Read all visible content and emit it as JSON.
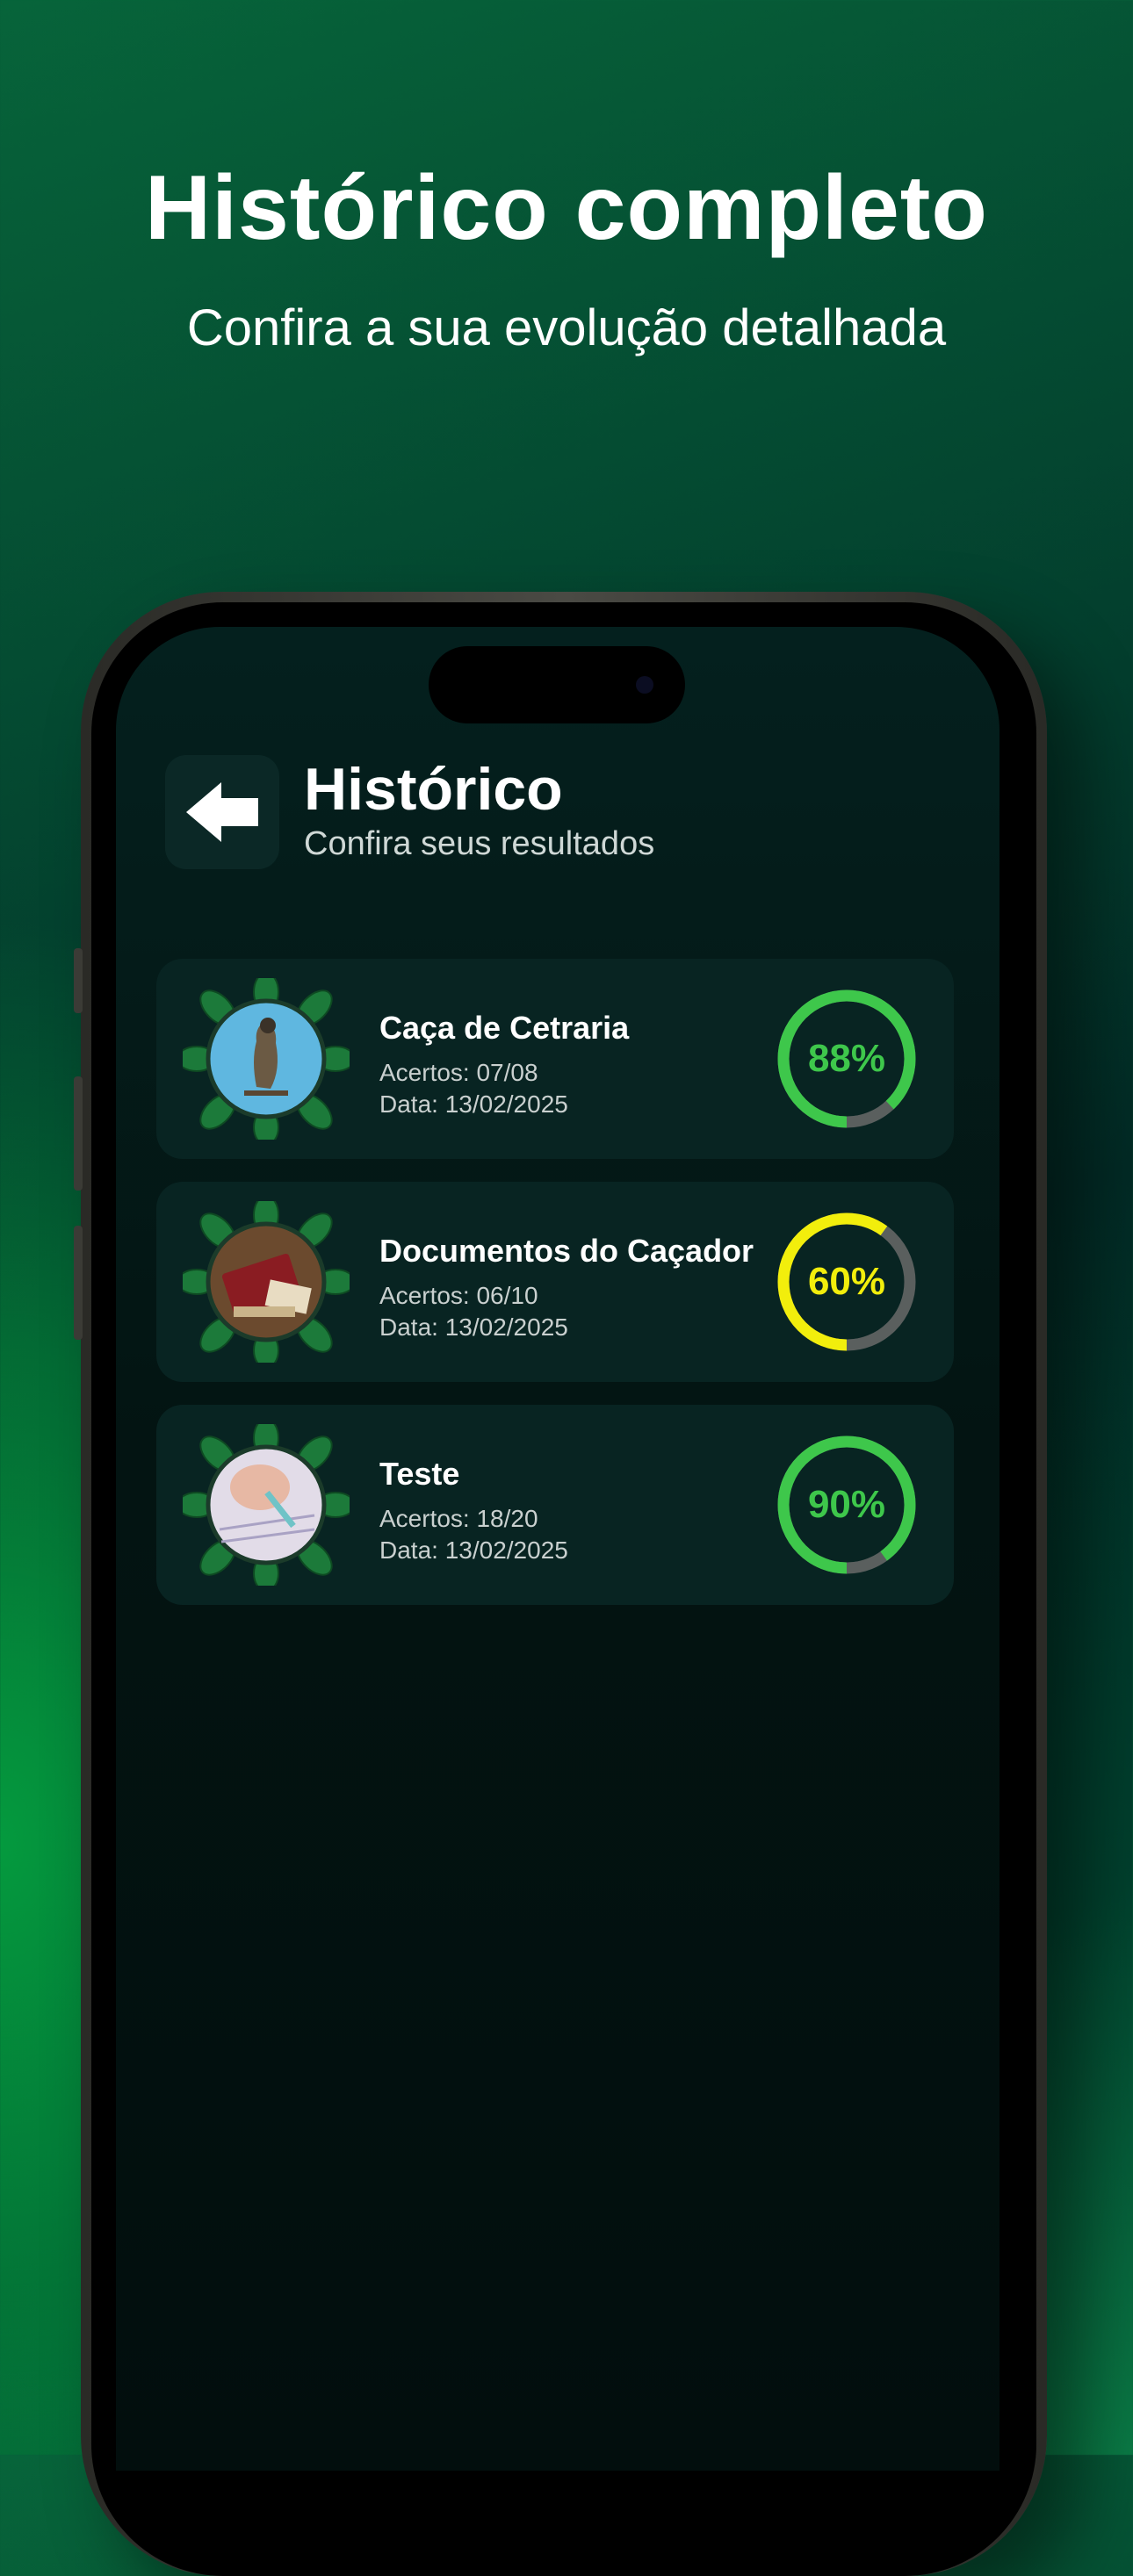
{
  "hero": {
    "title": "Histórico completo",
    "subtitle": "Confira a sua evolução detalhada"
  },
  "header": {
    "back_icon": "arrow-left-icon",
    "title": "Histórico",
    "subtitle": "Confira seus resultados"
  },
  "results": [
    {
      "title": "Caça de Cetraria",
      "hits": "Acertos: 07/08",
      "date": "Data: 13/02/2025",
      "percent": 88,
      "percent_label": "88%",
      "color": "#3ec74b",
      "thumbnail": "falcon-photo"
    },
    {
      "title": "Documentos do Caçador",
      "hits": "Acertos: 06/10",
      "date": "Data: 13/02/2025",
      "percent": 60,
      "percent_label": "60%",
      "color": "#f2ee0c",
      "thumbnail": "documents-photo"
    },
    {
      "title": "Teste",
      "hits": "Acertos: 18/20",
      "date": "Data: 13/02/2025",
      "percent": 90,
      "percent_label": "90%",
      "color": "#3ec74b",
      "thumbnail": "writing-hand-photo"
    }
  ],
  "colors": {
    "ring_track": "#5a5f5e",
    "card_bg": "#082422",
    "leaf_green": "#1c7a3a"
  }
}
